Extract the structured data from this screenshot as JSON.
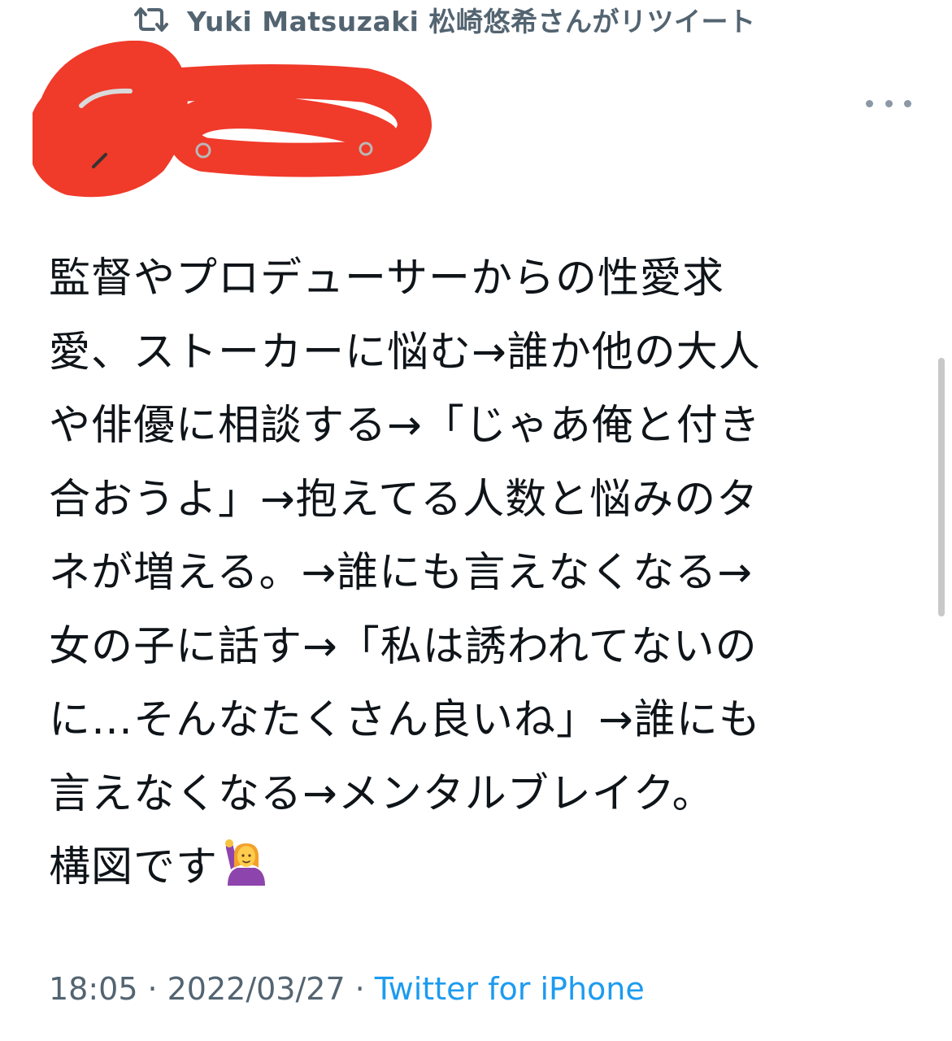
{
  "retweet": {
    "icon": "retweet-icon",
    "text": "Yuki Matsuzaki 松崎悠希さんがリツイート"
  },
  "tweet": {
    "lines": [
      "監督やプロデューサーからの性愛求",
      "愛、ストーカーに悩む→誰か他の大人",
      "や俳優に相談する→「じゃあ俺と付き",
      "合おうよ」→抱えてる人数と悩みのタ",
      "ネが増える。→誰にも言えなくなる→",
      "女の子に話す→「私は誘われてないの",
      "に…そんなたくさん良いね」→誰にも",
      "言えなくなる→メンタルブレイク。",
      "構図です"
    ],
    "emoji": "person-raising-hand-icon"
  },
  "meta": {
    "time": "18:05",
    "separator": "·",
    "date": "2022/03/27",
    "source": "Twitter for iPhone"
  },
  "colors": {
    "secondary_text": "#536471",
    "link": "#1d9bf0",
    "body_text": "#0f1419",
    "redaction": "#f03a2a"
  }
}
